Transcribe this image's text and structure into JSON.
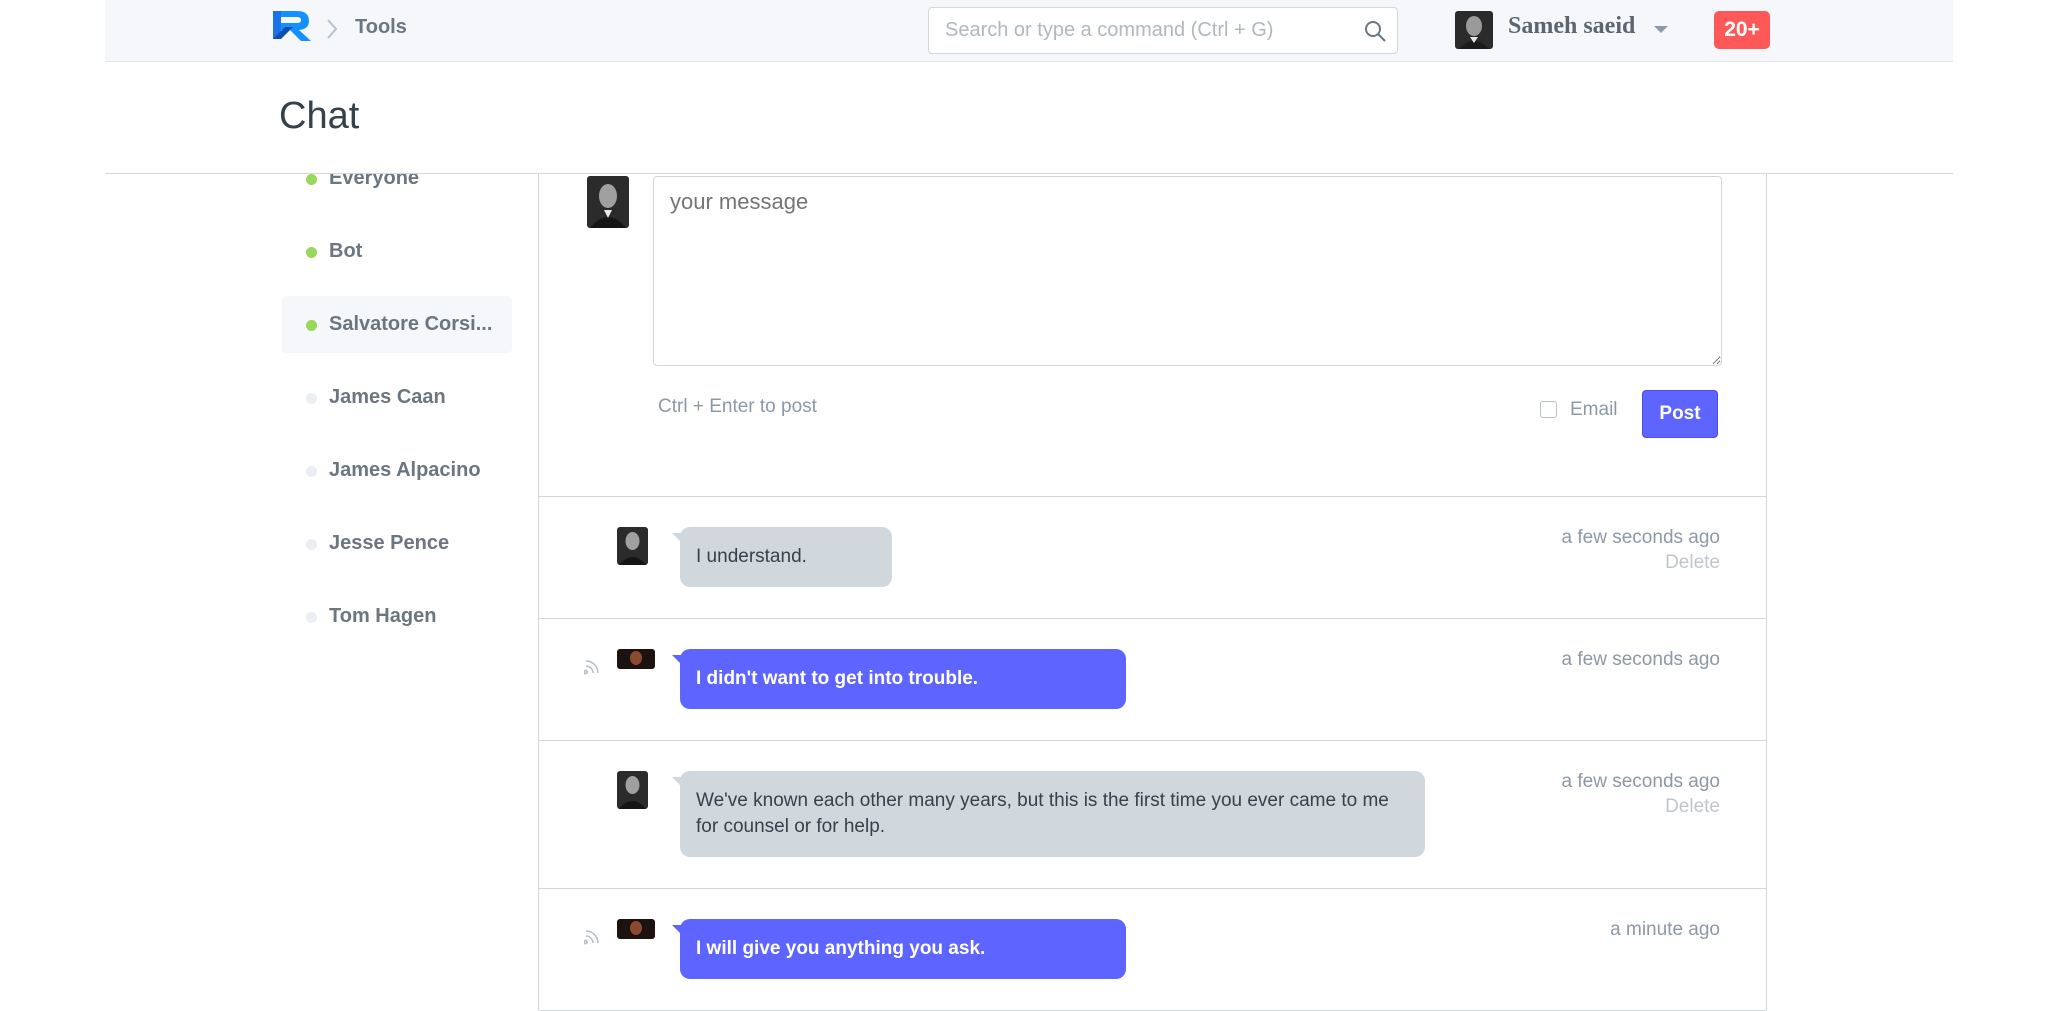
{
  "navbar": {
    "breadcrumb": "Tools",
    "search_placeholder": "Search or type a command (Ctrl + G)",
    "user_name": "Sameh saeid",
    "notification_count": "20+"
  },
  "page": {
    "title": "Chat"
  },
  "sidebar": {
    "items": [
      {
        "label": "Everyone",
        "online": true
      },
      {
        "label": "Bot",
        "online": true
      },
      {
        "label": "Salvatore Corsi...",
        "online": true,
        "active": true
      },
      {
        "label": "James Caan",
        "online": false
      },
      {
        "label": "James Alpacino",
        "online": false
      },
      {
        "label": "Jesse Pence",
        "online": false
      },
      {
        "label": "Tom Hagen",
        "online": false
      }
    ]
  },
  "composer": {
    "placeholder": "your message",
    "hint": "Ctrl + Enter to post",
    "email_label": "Email",
    "post_label": "Post"
  },
  "messages": [
    {
      "text": "I understand.",
      "time": "a few seconds ago",
      "delete": "Delete",
      "mine": false
    },
    {
      "text": "I didn't want to get into trouble.",
      "time": "a few seconds ago",
      "mine": true
    },
    {
      "text": "We've known each other many years, but this is the first time you ever came to me for counsel or for help.",
      "time": "a few seconds ago",
      "delete": "Delete",
      "mine": false
    },
    {
      "text": "I will give you anything you ask.",
      "time": "a minute ago",
      "mine": true
    }
  ],
  "colors": {
    "accent": "#5e64ff",
    "online": "#98d85b",
    "badge": "#ff5858"
  }
}
